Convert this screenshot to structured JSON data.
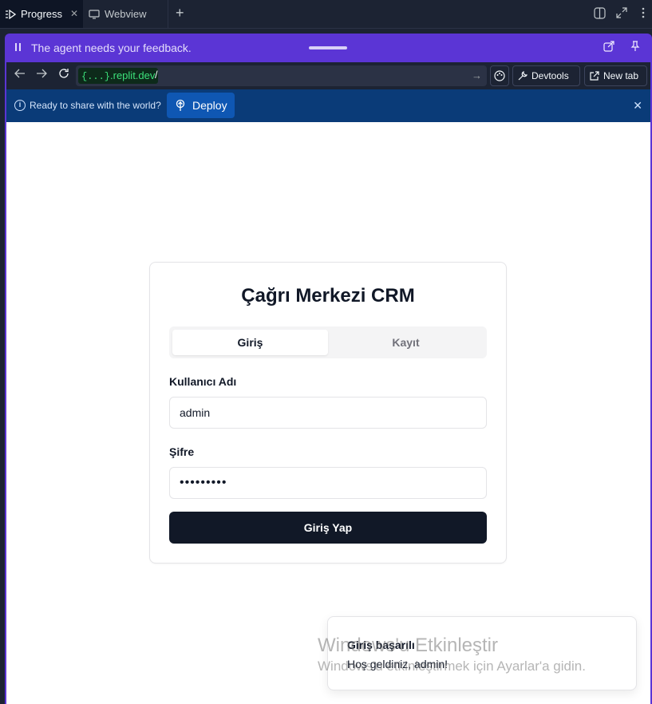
{
  "tabs": [
    {
      "label": "Progress",
      "icon": "progress-icon"
    },
    {
      "label": "Webview",
      "icon": "monitor-icon"
    }
  ],
  "feedback": {
    "message": "The agent needs your feedback."
  },
  "urlbar": {
    "domain_prefix": "{...}",
    "domain_suffix": ".replit.dev",
    "path": "/",
    "devtools_label": "Devtools",
    "newtab_label": "New tab"
  },
  "deploy_bar": {
    "message": "Ready to share with the world?",
    "button_label": "Deploy"
  },
  "login": {
    "title": "Çağrı Merkezi CRM",
    "tab_login": "Giriş",
    "tab_register": "Kayıt",
    "username_label": "Kullanıcı Adı",
    "username_value": "admin",
    "password_label": "Şifre",
    "password_value": "•••••••••",
    "submit_label": "Giriş Yap"
  },
  "toast": {
    "title": "Giriş başarılı",
    "description": "Hoş geldiniz, admin!"
  },
  "watermark": {
    "line1": "Windows'u Etkinleştir",
    "line2": "Windows'u etkinleştirmek için Ayarlar'a gidin."
  },
  "colors": {
    "panel_accent": "#5b35d5",
    "deploy_bar": "#0a3b78",
    "primary_button": "#111827",
    "domain_text": "#3ce07a"
  }
}
